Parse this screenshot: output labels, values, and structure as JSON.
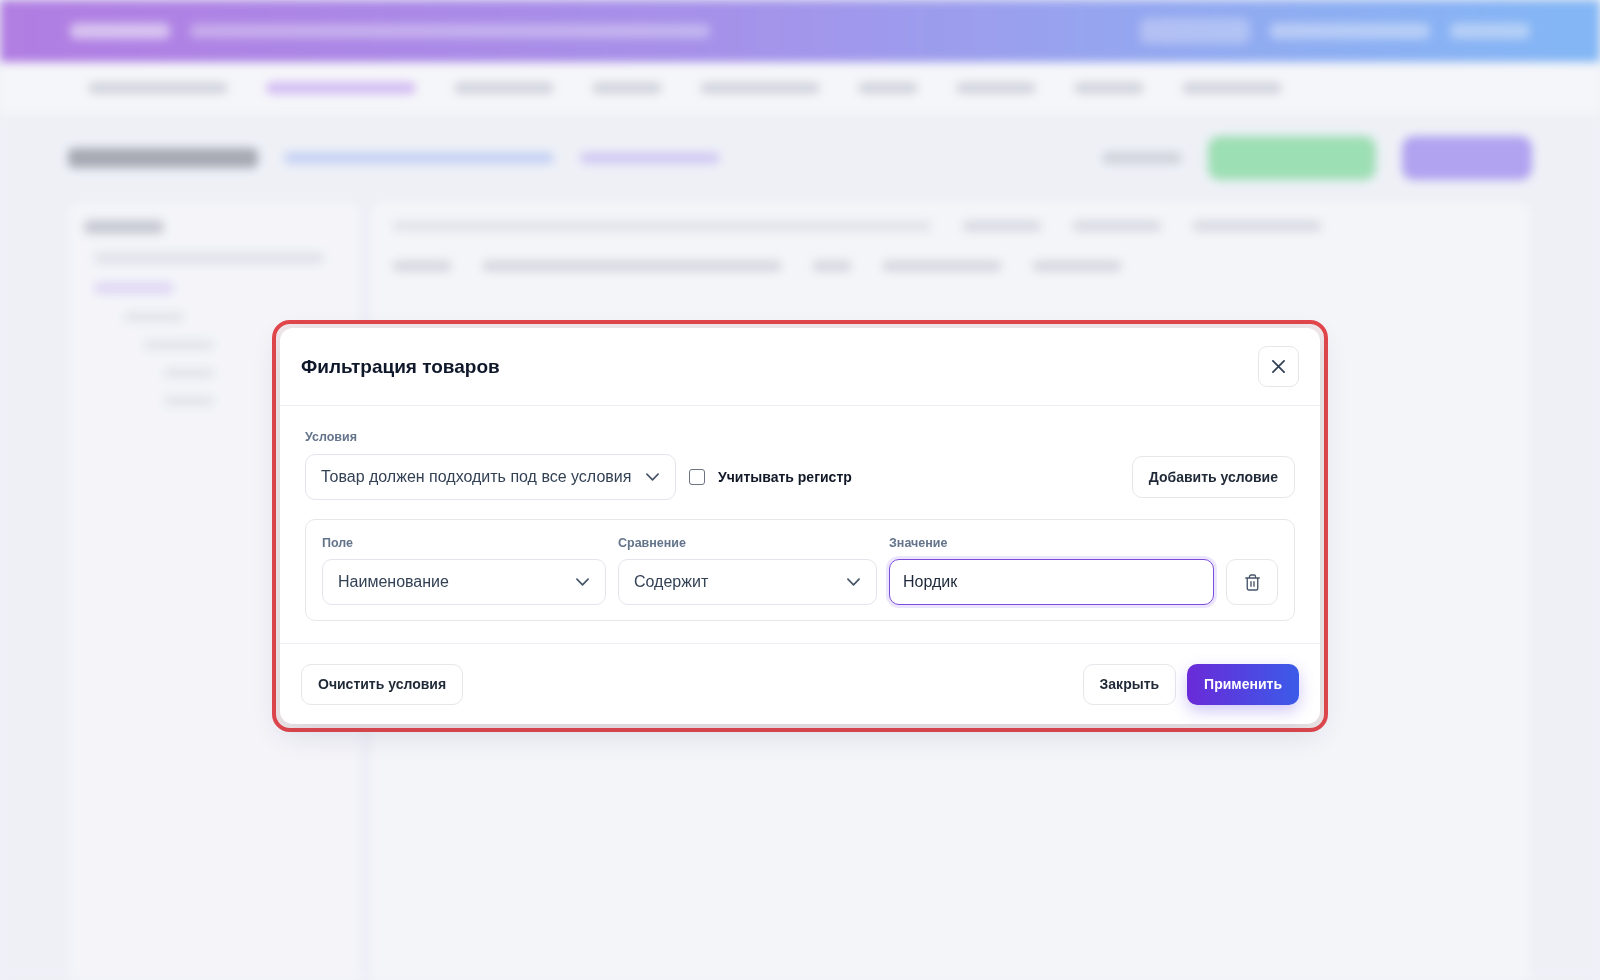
{
  "dialog": {
    "title": "Фильтрация товаров",
    "highlighted": true,
    "conditions": {
      "label": "Условия",
      "match_mode": "Товар должен подходить под все условия",
      "case_sensitive": {
        "label": "Учитывать регистр",
        "checked": false
      },
      "add_button": "Добавить условие"
    },
    "rules": [
      {
        "field": {
          "label": "Поле",
          "value": "Наименование"
        },
        "comparison": {
          "label": "Сравнение",
          "value": "Содержит"
        },
        "value": {
          "label": "Значение",
          "value": "Нордик",
          "focused": true
        }
      }
    ],
    "footer": {
      "clear_button": "Очистить условия",
      "close_button": "Закрыть",
      "apply_button": "Применить"
    }
  }
}
